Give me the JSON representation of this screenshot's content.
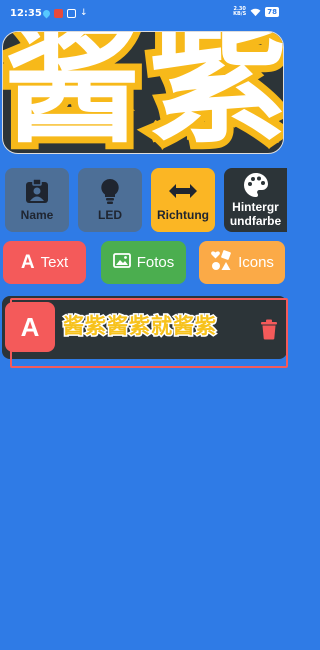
{
  "status": {
    "time": "12:35",
    "net_top": "2.30",
    "net_bottom": "KB/S",
    "battery": "78"
  },
  "banner": {
    "text": "酱紫"
  },
  "tiles": [
    {
      "label": "Name",
      "icon": "id-badge-icon"
    },
    {
      "label": "LED",
      "icon": "lightbulb-icon"
    },
    {
      "label": "Richtung",
      "icon": "arrows-horizontal-icon"
    },
    {
      "label": "Hintergr undfarbe",
      "icon": "palette-icon"
    }
  ],
  "tabs": [
    {
      "label": "Text",
      "icon": "text-icon",
      "glyph": "A"
    },
    {
      "label": "Fotos",
      "icon": "image-icon"
    },
    {
      "label": "Icons",
      "icon": "shapes-icon"
    }
  ],
  "item": {
    "badge": "A",
    "text": "酱紫酱紫就酱紫",
    "delete_icon": "trash-icon"
  },
  "colors": {
    "background": "#2f7be6",
    "accent_red": "#f45a5a",
    "accent_green": "#4bae4f",
    "accent_orange": "#fbaa47",
    "accent_yellow": "#fbb624",
    "dark": "#2c3438"
  }
}
